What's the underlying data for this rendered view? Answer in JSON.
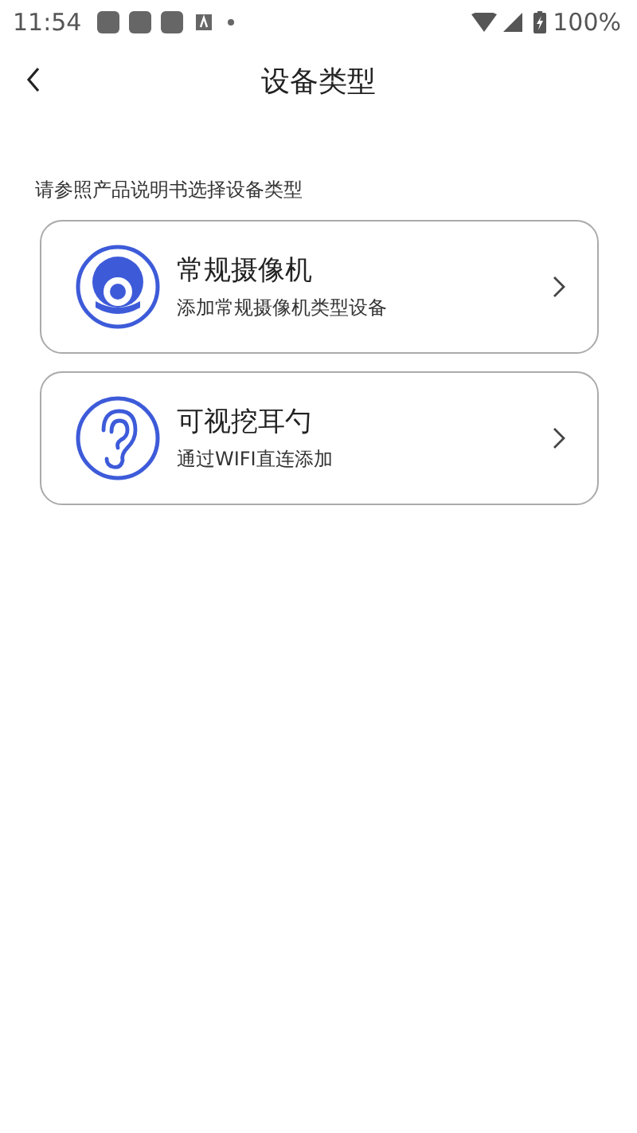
{
  "status_bar": {
    "time": "11:54",
    "battery": "100%"
  },
  "header": {
    "title": "设备类型"
  },
  "hint": "请参照产品说明书选择设备类型",
  "devices": [
    {
      "kind": "camera",
      "title": "常规摄像机",
      "subtitle": "添加常规摄像机类型设备"
    },
    {
      "kind": "ear",
      "title": "可视挖耳勺",
      "subtitle": "通过WIFI直连添加"
    }
  ]
}
